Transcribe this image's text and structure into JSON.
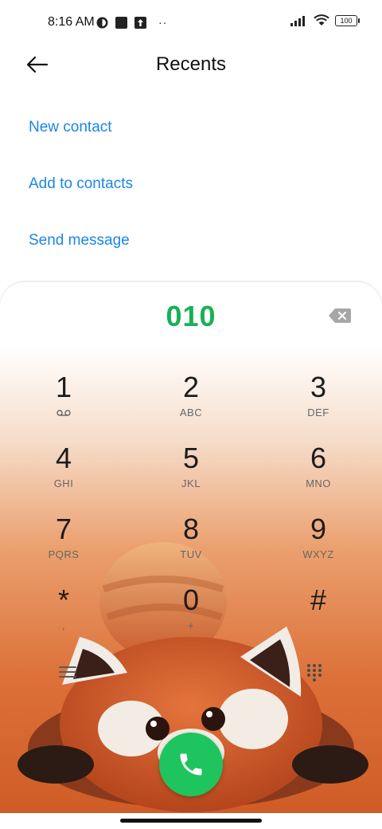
{
  "status_bar": {
    "time": "8:16 AM",
    "battery": "100",
    "icons": [
      "notification-app-icon",
      "square-icon",
      "upload-icon",
      "more-dots-icon",
      "signal-icon",
      "wifi-icon",
      "battery-icon"
    ],
    "more_dots": "··"
  },
  "header": {
    "title": "Recents",
    "back_icon": "arrow-left-icon"
  },
  "actions": {
    "new_contact": "New contact",
    "add_to_contacts": "Add to contacts",
    "send_message": "Send message"
  },
  "dialer": {
    "number": "010",
    "backspace_icon": "backspace-icon",
    "keys": [
      {
        "digit": "1",
        "letters": "voicemail-icon"
      },
      {
        "digit": "2",
        "letters": "ABC"
      },
      {
        "digit": "3",
        "letters": "DEF"
      },
      {
        "digit": "4",
        "letters": "GHI"
      },
      {
        "digit": "5",
        "letters": "JKL"
      },
      {
        "digit": "6",
        "letters": "MNO"
      },
      {
        "digit": "7",
        "letters": "PQRS"
      },
      {
        "digit": "8",
        "letters": "TUV"
      },
      {
        "digit": "9",
        "letters": "WXYZ"
      },
      {
        "digit": "*",
        "letters": ","
      },
      {
        "digit": "0",
        "letters": "+"
      },
      {
        "digit": "#",
        "letters": ""
      }
    ],
    "menu_icon": "menu-icon",
    "keypad_icon": "keypad-icon",
    "call_icon": "phone-icon"
  },
  "colors": {
    "accent_blue": "#1a86e8",
    "number_green": "#17b155",
    "call_green": "#1ec45e",
    "wallpaper_orange": "#d9622a"
  }
}
